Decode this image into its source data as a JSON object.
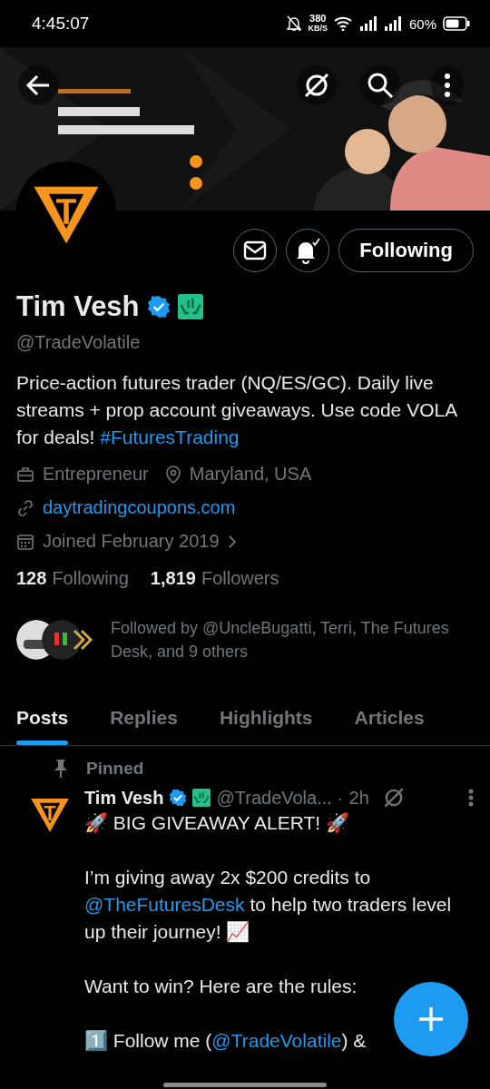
{
  "status_bar": {
    "time": "4:45:07",
    "speed": "380",
    "speed_unit": "KB/S",
    "battery": "60%"
  },
  "profile": {
    "name": "Tim Vesh",
    "handle": "@TradeVolatile",
    "follow_label": "Following",
    "bio": [
      {
        "kind": "text",
        "text": "Price-action futures trader (NQ/ES/GC). Daily live streams + prop account giveaways. Use code VOLA for deals! "
      },
      {
        "kind": "link",
        "text": "#FuturesTrading"
      }
    ],
    "meta": [
      [
        {
          "kind": "job",
          "text": "Entrepreneur"
        },
        {
          "kind": "location",
          "text": "Maryland, USA"
        }
      ],
      [
        {
          "kind": "website",
          "text": "daytradingcoupons.com"
        }
      ],
      [
        {
          "kind": "joined",
          "text": "Joined February 2019"
        }
      ]
    ],
    "stats": [
      {
        "count": "128",
        "label": "Following"
      },
      {
        "count": "1,819",
        "label": "Followers"
      }
    ],
    "followed_by": "Followed by @UncleBugatti, Terri, The Futures Desk, and 9 others"
  },
  "tabs": [
    {
      "label": "Posts",
      "selected": true
    },
    {
      "label": "Replies",
      "selected": false
    },
    {
      "label": "Highlights",
      "selected": false
    },
    {
      "label": "Articles",
      "selected": false
    }
  ],
  "pinned_post": {
    "pinned_label": "Pinned",
    "name": "Tim Vesh",
    "handle": "@TradeVola...",
    "separator": "·",
    "time": "2h",
    "paragraphs": [
      [
        {
          "kind": "text",
          "text": "🚀 BIG GIVEAWAY ALERT! 🚀"
        }
      ],
      [
        {
          "kind": "text",
          "text": "I’m giving away 2x $200 credits to "
        },
        {
          "kind": "link",
          "text": "@TheFuturesDesk"
        },
        {
          "kind": "text",
          "text": " to help two traders level up their journey! 📈"
        }
      ],
      [
        {
          "kind": "text",
          "text": "Want to win? Here are the rules:"
        }
      ],
      [
        {
          "kind": "text",
          "text": "1️⃣ Follow me ("
        },
        {
          "kind": "link",
          "text": "@TradeVolatile"
        },
        {
          "kind": "text",
          "text": ") &"
        }
      ]
    ]
  }
}
